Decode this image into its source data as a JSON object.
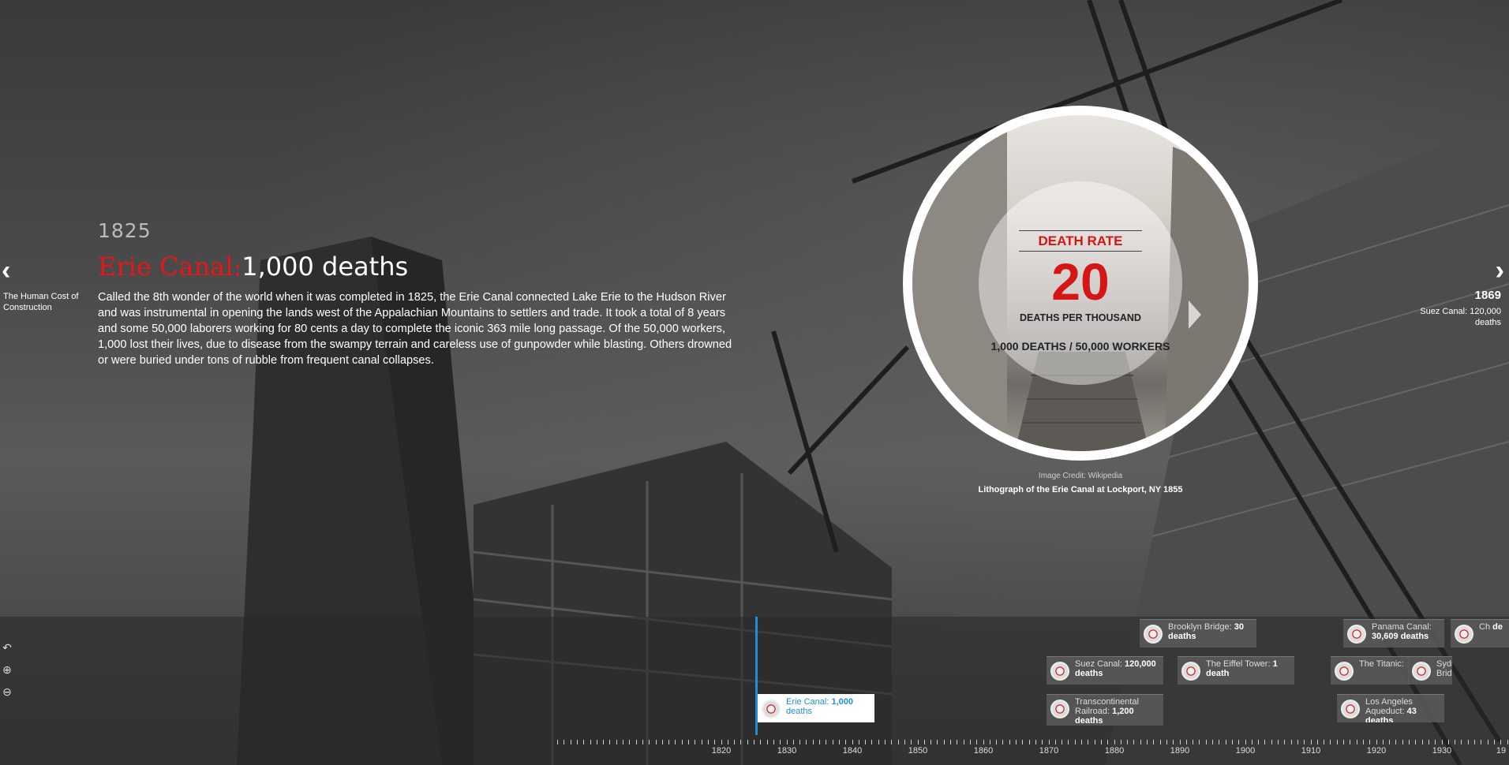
{
  "navigation": {
    "prev_label": "The Human Cost of Construction",
    "next_year": "1869",
    "next_label": "Suez Canal: 120,000 deaths"
  },
  "slide": {
    "year": "1825",
    "title_red": "Erie Canal:",
    "title_white": "1,000 deaths",
    "body": "Called the 8th wonder of the world when it was completed in 1825, the Erie Canal connected Lake Erie to the Hudson River and was instrumental in opening the lands west of the Appalachian Mountains to settlers and trade. It took a total of 8 years and some 50,000 laborers working for 80 cents a day to complete the iconic 363 mile long passage. Of the 50,000 workers, 1,000 lost their lives, due to disease from the swampy terrain and careless use of gunpowder while blasting. Others drowned or were buried under tons of rubble from frequent canal collapses."
  },
  "media": {
    "stat_label": "DEATH RATE",
    "stat_value": "20",
    "stat_unit": "DEATHS PER THOUSAND",
    "stat_ratio": "1,000 DEATHS / 50,000 WORKERS",
    "credit": "Image Credit: Wikipedia",
    "caption": "Lithograph of the Erie Canal at Lockport, NY 1855"
  },
  "timeline": {
    "tools": [
      "back-arrow-icon",
      "zoom-in-icon",
      "zoom-out-icon"
    ],
    "events": [
      {
        "name": "Erie Canal:",
        "deaths": "1,000",
        "suffix": "deaths",
        "active": true
      },
      {
        "name": "Transcontinental Railroad:",
        "deaths": "1,200",
        "suffix": "deaths"
      },
      {
        "name": "Suez Canal:",
        "deaths": "120,000",
        "suffix": "deaths"
      },
      {
        "name": "Brooklyn Bridge:",
        "deaths": "30",
        "suffix": "deaths"
      },
      {
        "name": "The Eiffel Tower:",
        "deaths": "1",
        "suffix": "death"
      },
      {
        "name": "Panama Canal:",
        "deaths": "30,609 deaths",
        "suffix": ""
      },
      {
        "name": "The Titanic:",
        "deaths": "",
        "suffix": ""
      },
      {
        "name": "Los Angeles Aqueduct:",
        "deaths": "43 deaths",
        "suffix": ""
      },
      {
        "name": "Sydn Bridg",
        "deaths": "",
        "suffix": ""
      },
      {
        "name": "Ch",
        "deaths": "de",
        "suffix": ""
      }
    ],
    "axis_labels": [
      "1820",
      "1830",
      "1840",
      "1850",
      "1860",
      "1870",
      "1880",
      "1890",
      "1900",
      "1910",
      "1920",
      "1930",
      "19"
    ]
  }
}
